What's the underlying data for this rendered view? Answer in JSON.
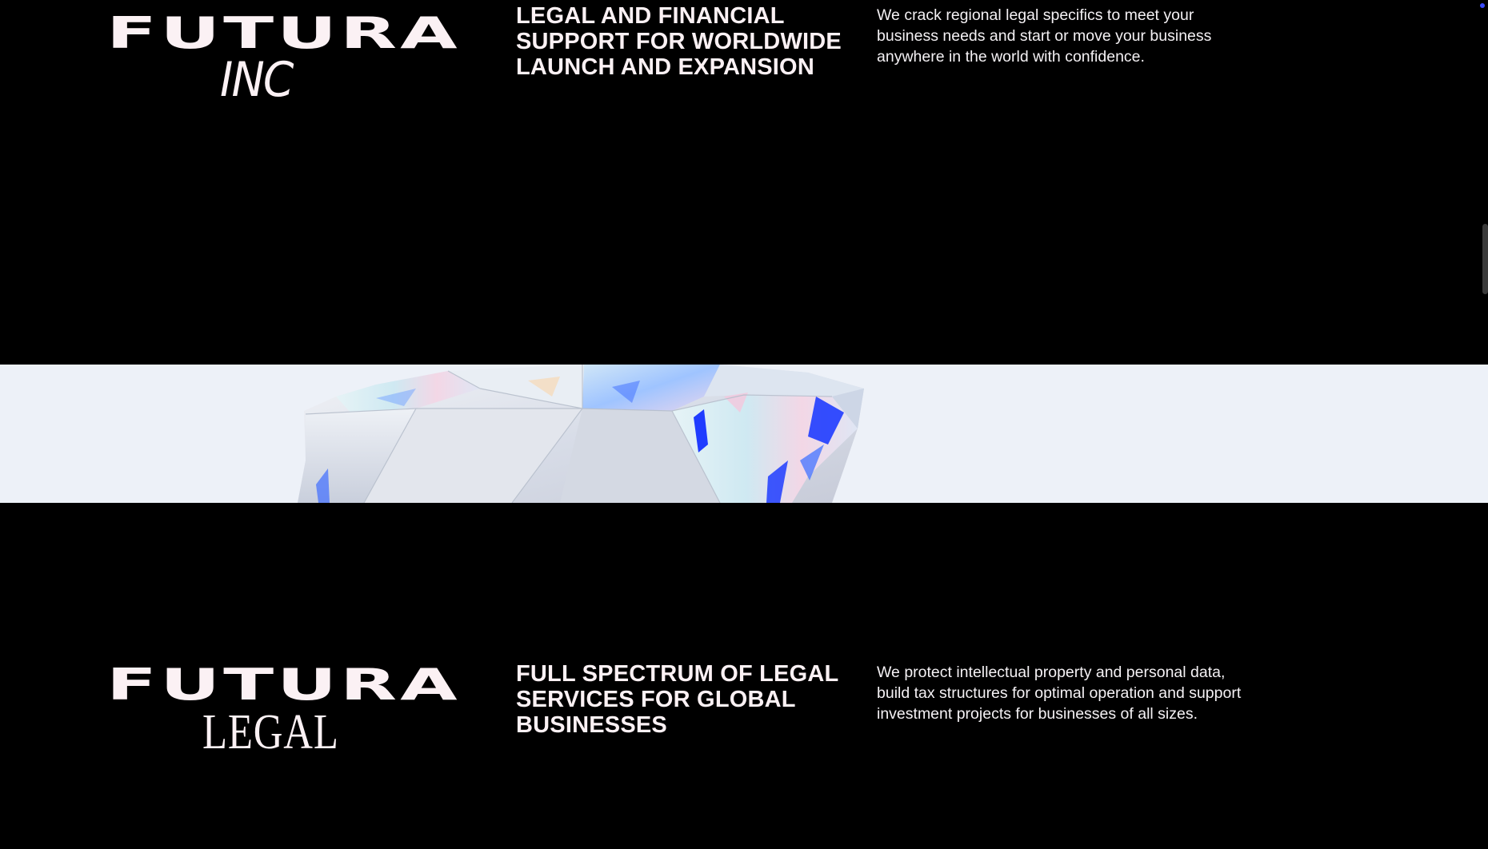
{
  "sections": [
    {
      "brand": "FUTURA",
      "sub_brand": "INC",
      "headline": "LEGAL AND FINANCIAL SUPPORT FOR WORLDWIDE LAUNCH AND EXPANSION",
      "description": "We crack regional legal specifics to meet your business needs and start or move your business anywhere in the world with confidence."
    },
    {
      "brand": "FUTURA",
      "sub_brand": "LEGAL",
      "headline": "FULL SPECTRUM OF LEGAL SERVICES FOR GLOBAL BUSINESSES",
      "description": "We protect intellectual property and personal data, build tax structures for optimal operation and support investment projects for businesses of all sizes."
    }
  ],
  "colors": {
    "background": "#000000",
    "text": "#fbf1f4",
    "band": "#edf1f8",
    "accent_blue": "#1f3cff"
  },
  "icons": {
    "hero_image": "crystal-gem-image",
    "scrollbar": "scrollbar-thumb",
    "corner": "status-dot-icon"
  }
}
